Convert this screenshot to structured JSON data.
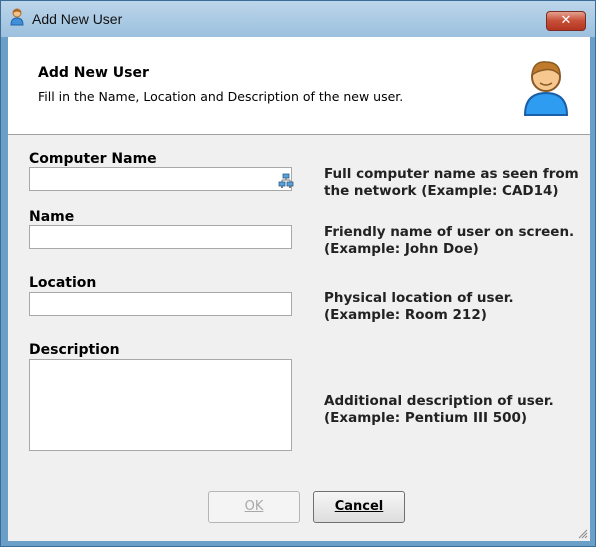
{
  "window": {
    "title": "Add New User",
    "close_glyph": "✕"
  },
  "header": {
    "title": "Add New User",
    "subtitle": "Fill in the Name, Location and Description of the new user.",
    "icon": "user-icon"
  },
  "fields": {
    "computer_name": {
      "label": "Computer Name",
      "value": "",
      "help_line1": "Full computer name as seen from",
      "help_line2": "the network (Example: CAD14)",
      "browse_icon": "network-computers-icon"
    },
    "name": {
      "label": "Name",
      "value": "",
      "help_line1": "Friendly name of user on screen.",
      "help_line2": "(Example: John Doe)"
    },
    "location": {
      "label": "Location",
      "value": "",
      "help_line1": "Physical location of user.",
      "help_line2": "(Example: Room 212)"
    },
    "description": {
      "label": "Description",
      "value": "",
      "help_line1": "Additional description of user.",
      "help_line2": "(Example:  Pentium III 500)"
    }
  },
  "buttons": {
    "ok": {
      "label": "OK",
      "enabled": false
    },
    "cancel": {
      "label": "Cancel"
    }
  },
  "colors": {
    "window_border": "#6aa0c8",
    "close_button": "#c74f37",
    "dialog_bg": "#f0f0f0"
  }
}
